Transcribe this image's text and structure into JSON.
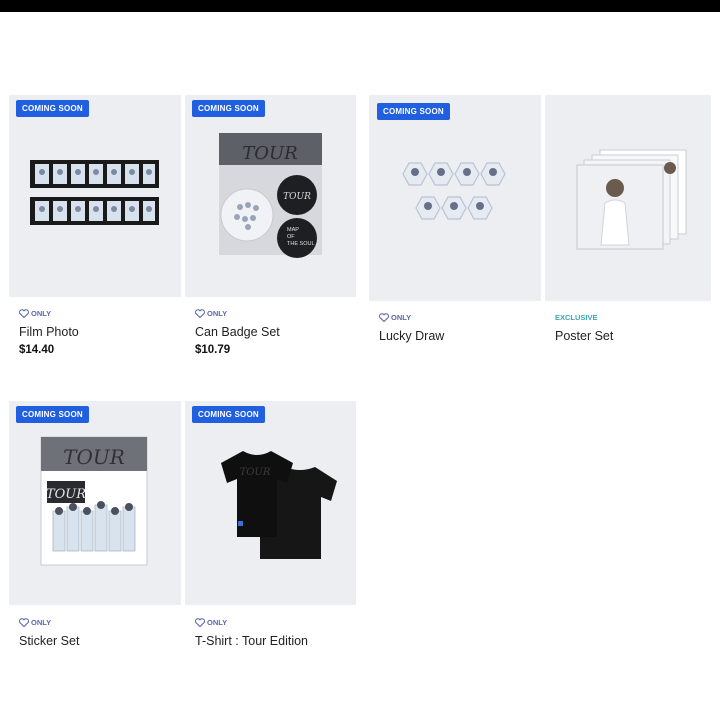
{
  "products": [
    {
      "name": "Film Photo",
      "tag": "ONLY",
      "price": "$14.40",
      "badge": "COMING SOON"
    },
    {
      "name": "Can Badge Set",
      "tag": "ONLY",
      "price": "$10.79",
      "badge": "COMING SOON"
    },
    {
      "name": "Lucky Draw",
      "tag": "ONLY",
      "badge": "COMING SOON"
    },
    {
      "name": "Poster Set",
      "tag": "EXCLUSIVE"
    },
    {
      "name": "Sticker Set",
      "tag": "ONLY",
      "badge": "COMING SOON"
    },
    {
      "name": "T-Shirt : Tour Edition",
      "tag": "ONLY",
      "badge": "COMING SOON"
    }
  ],
  "artwork": {
    "tour_text": "TOUR",
    "map_text": "MAP\nOF\nTHE SOUL"
  },
  "icons": {
    "tag_icon": "heart-check-icon"
  },
  "colors": {
    "badge": "#1f5fe0",
    "only_tag": "#5a6aa8",
    "exclusive_tag": "#3aa6b8",
    "thumb_bg": "#edeef2"
  }
}
